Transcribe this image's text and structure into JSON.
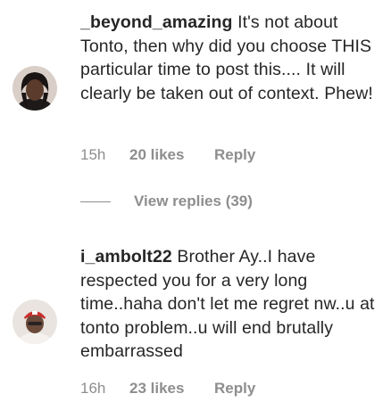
{
  "comments": [
    {
      "username": "_beyond_amazing",
      "text": "It's not about Tonto, then why did you choose THIS particular time to post this.... It will clearly be taken out of context. Phew!",
      "time": "15h",
      "likes": "20 likes",
      "reply": "Reply"
    },
    {
      "username": "i_ambolt22",
      "text": "Brother Ay..I have respected you for a very long time..haha don't let me regret nw..u at tonto problem..u will end brutally embarrassed",
      "time": "16h",
      "likes": "23 likes",
      "reply": "Reply"
    }
  ],
  "view_replies": "View replies (39)",
  "colors": {
    "text": "#262626",
    "muted": "#8e8e8e"
  }
}
